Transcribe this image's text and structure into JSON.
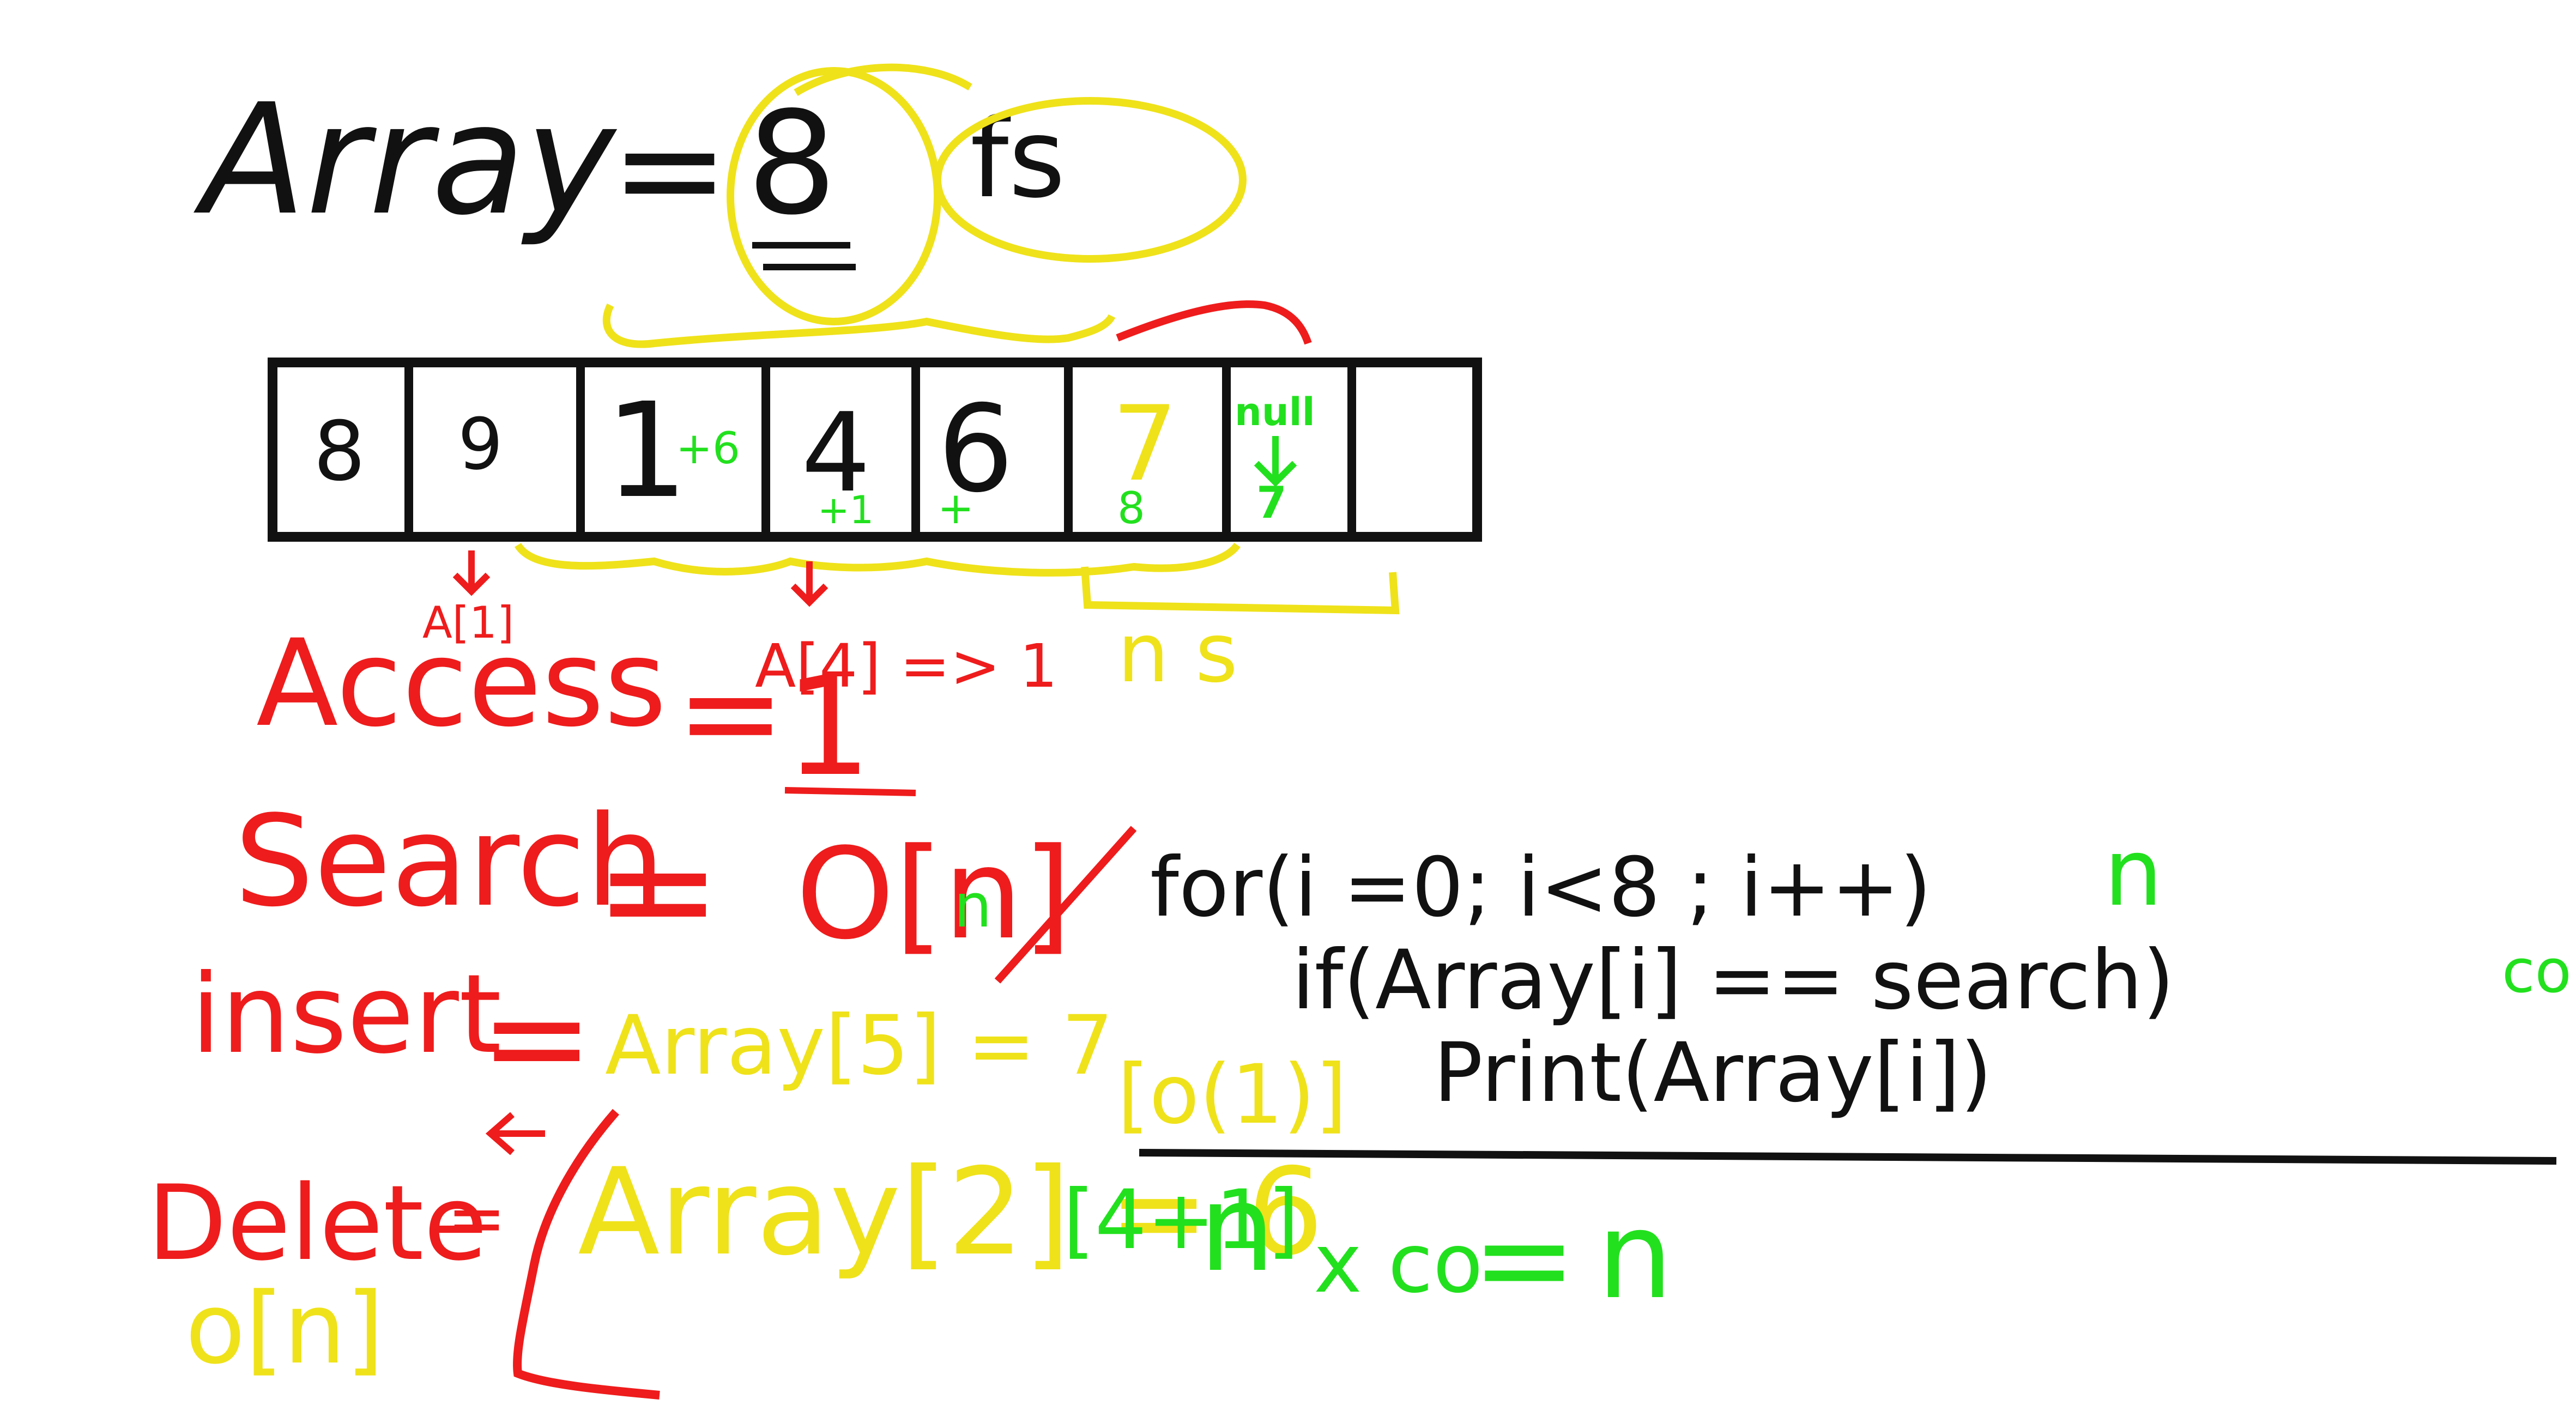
{
  "title": {
    "word": "Array",
    "equals": "=",
    "size": "8",
    "suffix": "fs"
  },
  "array": {
    "cells": [
      "8",
      "9",
      "1",
      "4",
      "6",
      "7",
      "",
      ""
    ],
    "annotations": {
      "cell2": "+6",
      "cell3": "+1",
      "cell4": "+",
      "cell5": "8",
      "cell6_top": "null",
      "cell6_bottom": "7"
    }
  },
  "labels": {
    "a1": "A[1]",
    "a4": "A[4] => 1",
    "ns": "n s"
  },
  "access": {
    "label": "Access",
    "equals": "=",
    "value": "1"
  },
  "search": {
    "label": "Search",
    "equals": "=",
    "value": "O[n]",
    "n_marker": "n"
  },
  "code": {
    "line1": "for(i =0; i<8 ; i++)",
    "line1_cost": "n",
    "line2": "if(Array[i] == search)",
    "line2_cost": "co",
    "line3": "Print(Array[i])"
  },
  "insert": {
    "label": "insert",
    "equals": "=",
    "value": "Array[5] = 7",
    "complexity": "[o(1)]"
  },
  "delete": {
    "label": "Delete",
    "equals": "=",
    "complexity": "o[n]"
  },
  "shift": {
    "expression": "Array[2] = 6",
    "cost": "[4+1]",
    "n1": "n",
    "times": "x co",
    "equals": "=",
    "n2": "n"
  },
  "colors": {
    "black": "#111111",
    "red": "#ee1c1c",
    "yellow": "#efe21a",
    "green": "#22e01e"
  }
}
